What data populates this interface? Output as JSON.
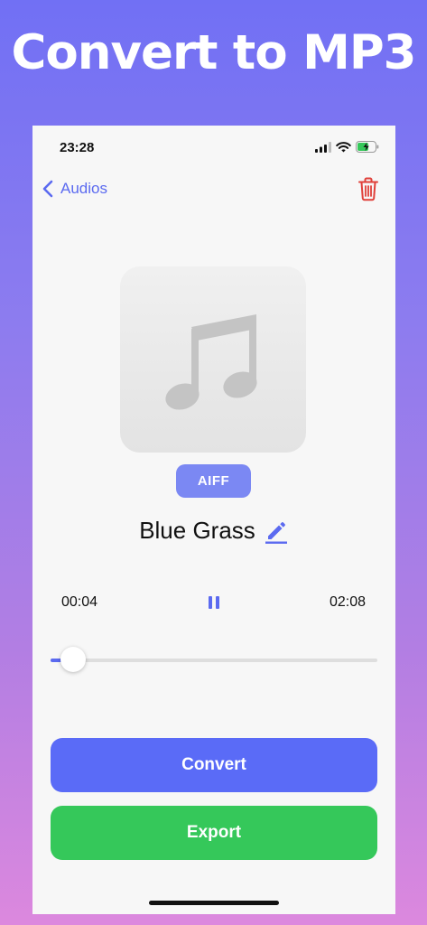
{
  "promo": {
    "headline": "Convert to MP3"
  },
  "status_bar": {
    "time": "23:28"
  },
  "nav": {
    "back_label": "Audios"
  },
  "track": {
    "format": "AIFF",
    "title": "Blue Grass"
  },
  "player": {
    "elapsed": "00:04",
    "total": "02:08",
    "progress_fraction": 0.07
  },
  "actions": {
    "convert_label": "Convert",
    "export_label": "Export"
  },
  "colors": {
    "accent": "#5b6af0",
    "convert": "#5a6bf7",
    "export": "#35c85a",
    "delete": "#e0403a",
    "badge": "#7b88f3"
  },
  "icons": {
    "back": "chevron-left-icon",
    "delete": "trash-icon",
    "artwork": "music-note-icon",
    "edit": "pencil-icon",
    "playback": "pause-icon"
  }
}
